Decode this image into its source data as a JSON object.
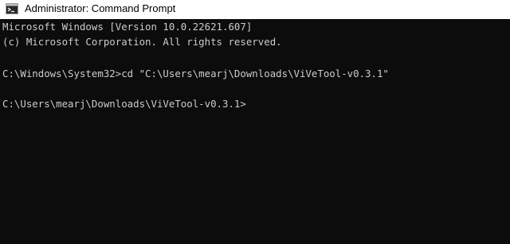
{
  "window": {
    "title": "Administrator: Command Prompt",
    "icon": "cmd-icon"
  },
  "console": {
    "lines": [
      "Microsoft Windows [Version 10.0.22621.607]",
      "(c) Microsoft Corporation. All rights reserved.",
      "",
      "C:\\Windows\\System32>cd \"C:\\Users\\mearj\\Downloads\\ViVeTool-v0.3.1\"",
      "",
      "C:\\Users\\mearj\\Downloads\\ViVeTool-v0.3.1>"
    ],
    "text_color": "#cccccc",
    "background": "#0c0c0c"
  }
}
